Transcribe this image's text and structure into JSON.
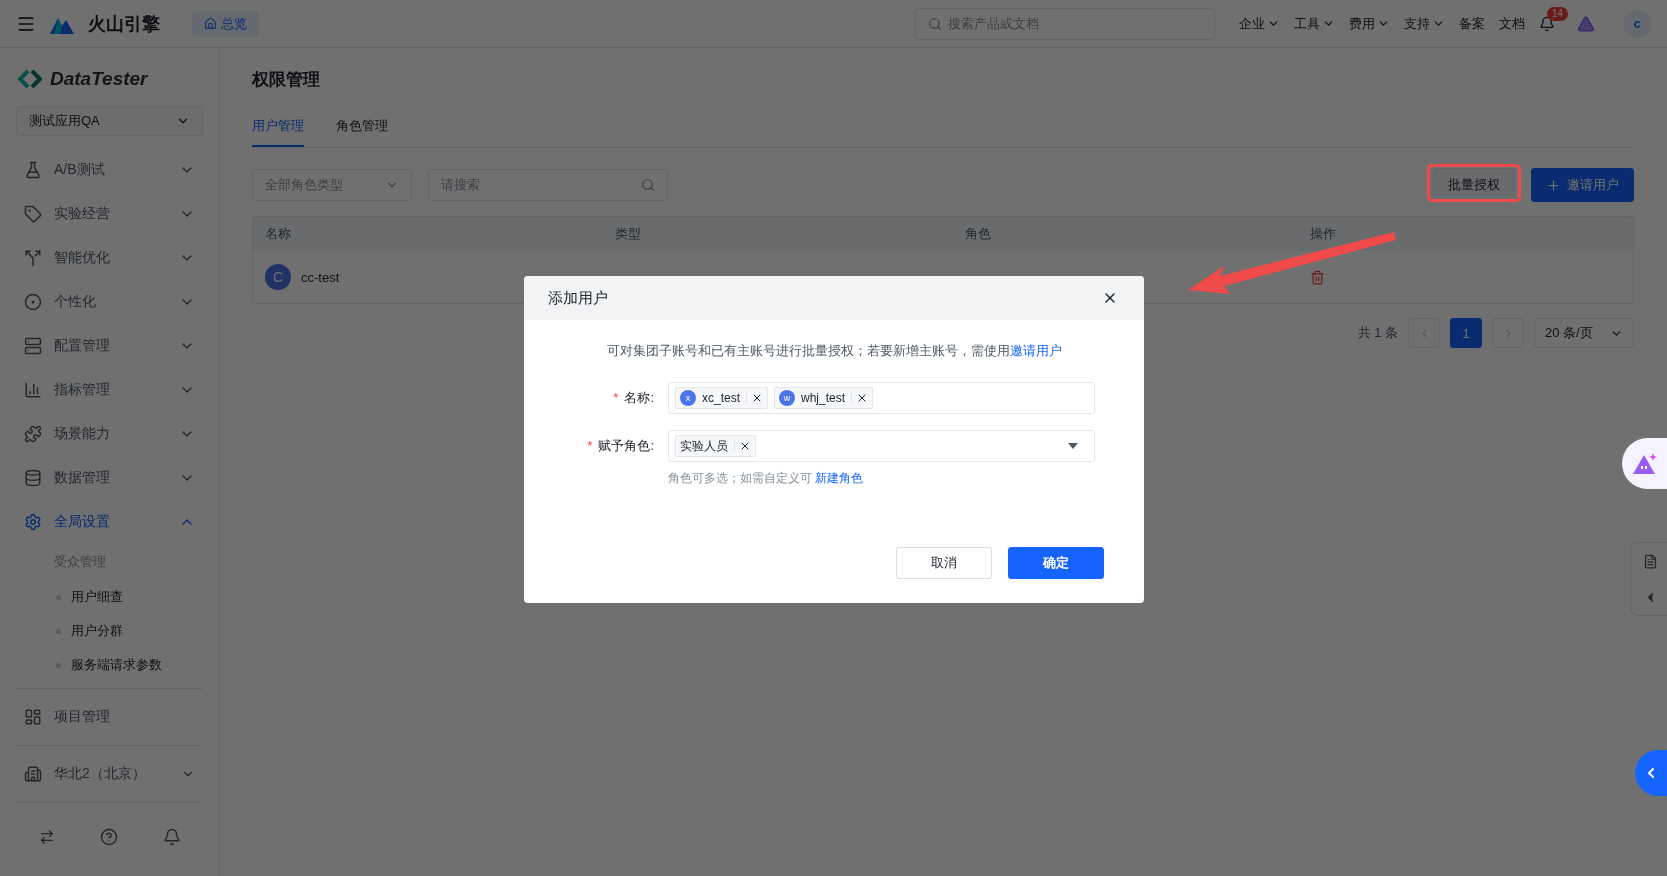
{
  "topbar": {
    "brand": "火山引擎",
    "home_tab": "总览",
    "search": {
      "placeholder": "搜索产品或文档"
    },
    "menu": [
      {
        "label": "企业",
        "kind": "dropdown"
      },
      {
        "label": "工具",
        "kind": "dropdown"
      },
      {
        "label": "费用",
        "kind": "dropdown"
      },
      {
        "label": "支持",
        "kind": "dropdown"
      },
      {
        "label": "备案",
        "kind": "link"
      },
      {
        "label": "文档",
        "kind": "link"
      }
    ],
    "notifications": "14",
    "avatar": "c"
  },
  "sidebar": {
    "product": "DataTester",
    "app_select": "测试应用QA",
    "items": [
      {
        "label": "A/B测试",
        "selected": false,
        "expanded": false
      },
      {
        "label": "实验经营",
        "selected": false,
        "expanded": false
      },
      {
        "label": "智能优化",
        "selected": false,
        "expanded": false
      },
      {
        "label": "个性化",
        "selected": false,
        "expanded": false
      },
      {
        "label": "配置管理",
        "selected": false,
        "expanded": false
      },
      {
        "label": "指标管理",
        "selected": false,
        "expanded": false
      },
      {
        "label": "场景能力",
        "selected": false,
        "expanded": false
      },
      {
        "label": "数据管理",
        "selected": false,
        "expanded": false
      },
      {
        "label": "全局设置",
        "selected": true,
        "expanded": true,
        "children": [
          {
            "label": "受众管理",
            "selected": false,
            "children": [
              {
                "label": "用户细查",
                "selected": false
              },
              {
                "label": "用户分群",
                "selected": false
              },
              {
                "label": "服务端请求参数",
                "selected": false
              }
            ]
          }
        ]
      }
    ],
    "project": "项目管理",
    "region": "华北2（北京）"
  },
  "page": {
    "title": "权限管理",
    "tabs": [
      {
        "label": "用户管理",
        "selected": true
      },
      {
        "label": "角色管理",
        "selected": false
      }
    ],
    "filters": {
      "role_type": {
        "placeholder": "全部角色类型"
      },
      "search": {
        "placeholder": "请搜索"
      }
    },
    "actions": [
      {
        "label": "批量授权",
        "kind": "default"
      },
      {
        "label": "邀请用户",
        "kind": "primary"
      }
    ],
    "table": {
      "columns": [
        "名称",
        "类型",
        "角色",
        "操作"
      ],
      "rows": [
        {
          "initial": "C",
          "name": "cc-test"
        }
      ]
    },
    "pagination": {
      "total": "共 1 条",
      "pages": [
        {
          "label": "1",
          "selected": true
        }
      ],
      "page_size": "20 条/页"
    }
  },
  "dialog": {
    "title": "添加用户",
    "notice": "可对集团子账号和已有主账号进行批量授权；若要新增主账号，需使用",
    "notice_link": "邀请用户",
    "fields": [
      {
        "label": "名称:",
        "required_mark": "*",
        "kind": "users",
        "tags": [
          {
            "initial": "x",
            "label": "xc_test"
          },
          {
            "initial": "w",
            "label": "whj_test"
          }
        ]
      },
      {
        "label": "赋予角色:",
        "required_mark": "*",
        "kind": "select",
        "tags": [
          {
            "label": "实验人员"
          }
        ],
        "hint": "角色可多选；如需自定义可 ",
        "hint_link": "新建角色"
      }
    ],
    "buttons": [
      {
        "label": "取消",
        "kind": "default"
      },
      {
        "label": "确定",
        "kind": "primary"
      }
    ]
  }
}
